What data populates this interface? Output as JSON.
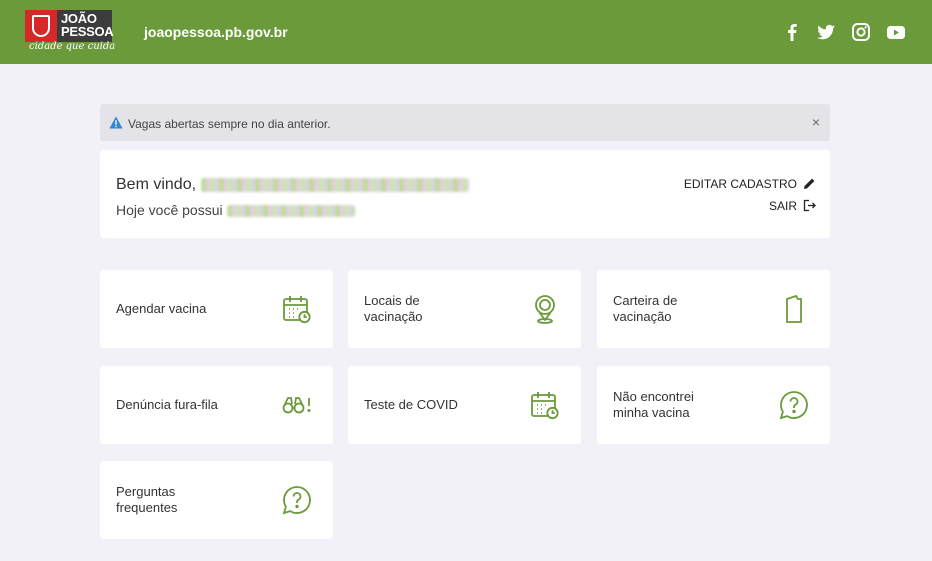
{
  "header": {
    "logo": {
      "line1": "JOÃO",
      "line2": "PESSOA",
      "tagline": "cidade que cuida"
    },
    "site_url": "joaopessoa.pb.gov.br",
    "social": [
      "facebook-icon",
      "twitter-icon",
      "instagram-icon",
      "youtube-icon"
    ]
  },
  "alert": {
    "text": "Vagas abertas sempre no dia anterior.",
    "close": "×"
  },
  "welcome": {
    "greeting": "Bem vindo,",
    "subtext": "Hoje você possui",
    "edit_label": "EDITAR CADASTRO",
    "logout_label": "SAIR"
  },
  "cards": [
    {
      "label": "Agendar vacina",
      "icon": "calendar-clock-icon"
    },
    {
      "label": "Locais de vacinação",
      "icon": "location-pin-icon"
    },
    {
      "label": "Carteira de vacinação",
      "icon": "vaccination-card-icon"
    },
    {
      "label": "Denúncia fura-fila",
      "icon": "binoculars-icon"
    },
    {
      "label": "Teste de COVID",
      "icon": "calendar-clock-icon"
    },
    {
      "label": "Não encontrei minha vacina",
      "icon": "question-bubble-icon"
    },
    {
      "label": "Perguntas frequentes",
      "icon": "question-bubble-icon"
    }
  ],
  "colors": {
    "header": "#6b9a3a",
    "icon": "#6b9a3a",
    "background": "#f1f1f7",
    "alert_icon": "#2f86d6"
  }
}
